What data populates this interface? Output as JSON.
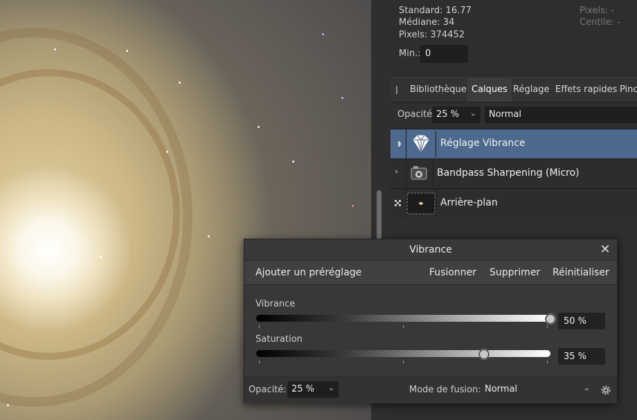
{
  "stats": {
    "standard": "Standard: 16.77",
    "median": "Médiane: 34",
    "pixels": "Pixels: 374452",
    "pixels_right": "Pixels: -",
    "centile_right": "Centile: -",
    "min_label": "Min.:",
    "min_value": "0"
  },
  "tabs": [
    {
      "label": "Bibliothèque"
    },
    {
      "label": "Calques"
    },
    {
      "label": "Réglage"
    },
    {
      "label": "Effets rapides"
    },
    {
      "label": "Pinc"
    }
  ],
  "layers_panel": {
    "opacity_label": "Opacité:",
    "opacity_value": "25 %",
    "blend_mode": "Normal"
  },
  "layers": [
    {
      "name": "Réglage Vibrance",
      "icon": "diamond-icon",
      "selected": true
    },
    {
      "name": "Bandpass Sharpening (Micro)",
      "icon": "live-filter-icon",
      "selected": false
    },
    {
      "name": "Arrière-plan",
      "icon": "image-thumbnail",
      "selected": false
    }
  ],
  "dialog": {
    "title": "Vibrance",
    "add_preset": "Ajouter un préréglage",
    "merge": "Fusionner",
    "delete": "Supprimer",
    "reset": "Réinitialiser",
    "vibrance_label": "Vibrance",
    "vibrance_value": "50 %",
    "vibrance_level": 0.5,
    "saturation_label": "Saturation",
    "saturation_value": "35 %",
    "saturation_level": 0.35,
    "opacity_label": "Opacité:",
    "opacity_value": "25 %",
    "blend_label": "Mode de fusion:",
    "blend_value": "Normal"
  }
}
